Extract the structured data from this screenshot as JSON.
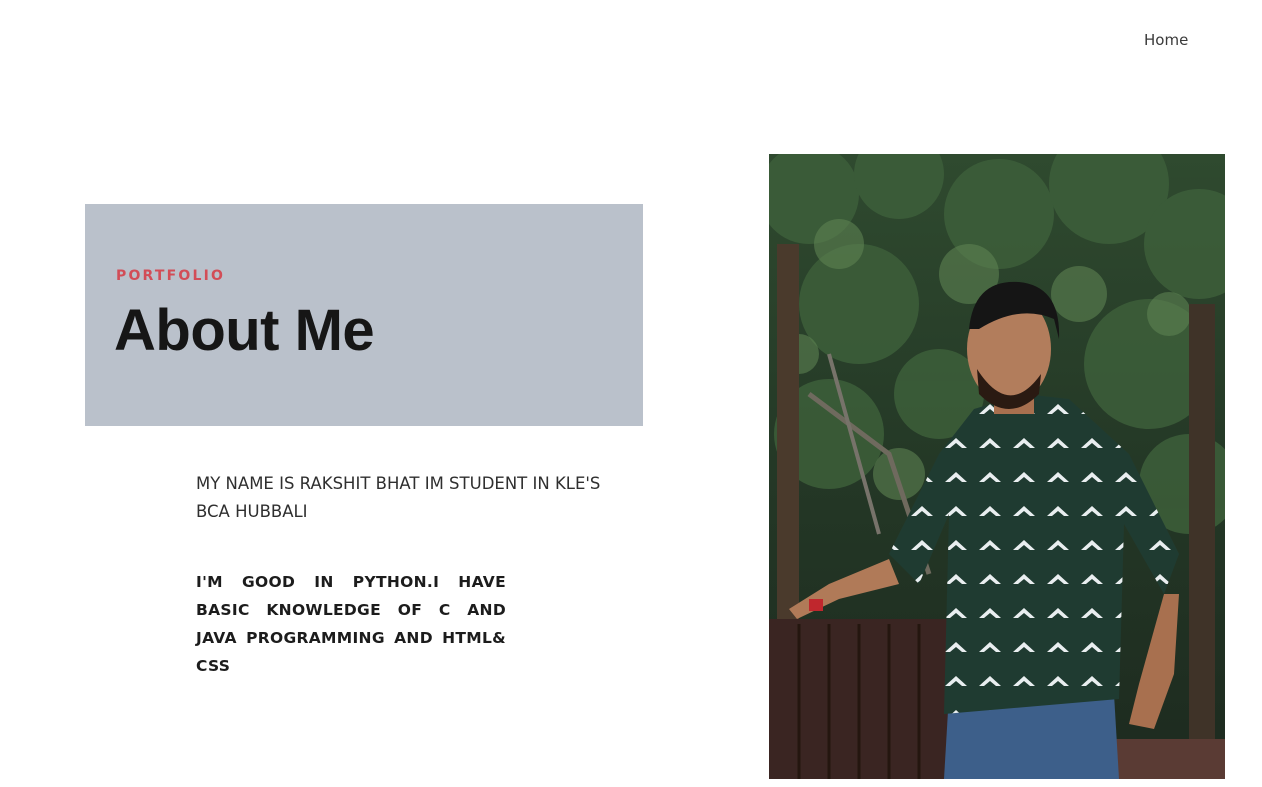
{
  "nav": {
    "home_label": "Home"
  },
  "hero": {
    "eyebrow": "PORTFOLIO",
    "title": "About Me"
  },
  "content": {
    "intro": "MY  NAME IS RAKSHIT BHAT IM STUDENT IN KLE'S BCA HUBBALI",
    "skills": "I'M GOOD IN PYTHON.I HAVE BASIC KNOWLEDGE OF C AND JAVA PROGRAMMING AND HTML& CSS"
  },
  "colors": {
    "hero_background": "#bac1cb",
    "eyebrow_accent": "#d24d57",
    "title_text": "#161616"
  }
}
